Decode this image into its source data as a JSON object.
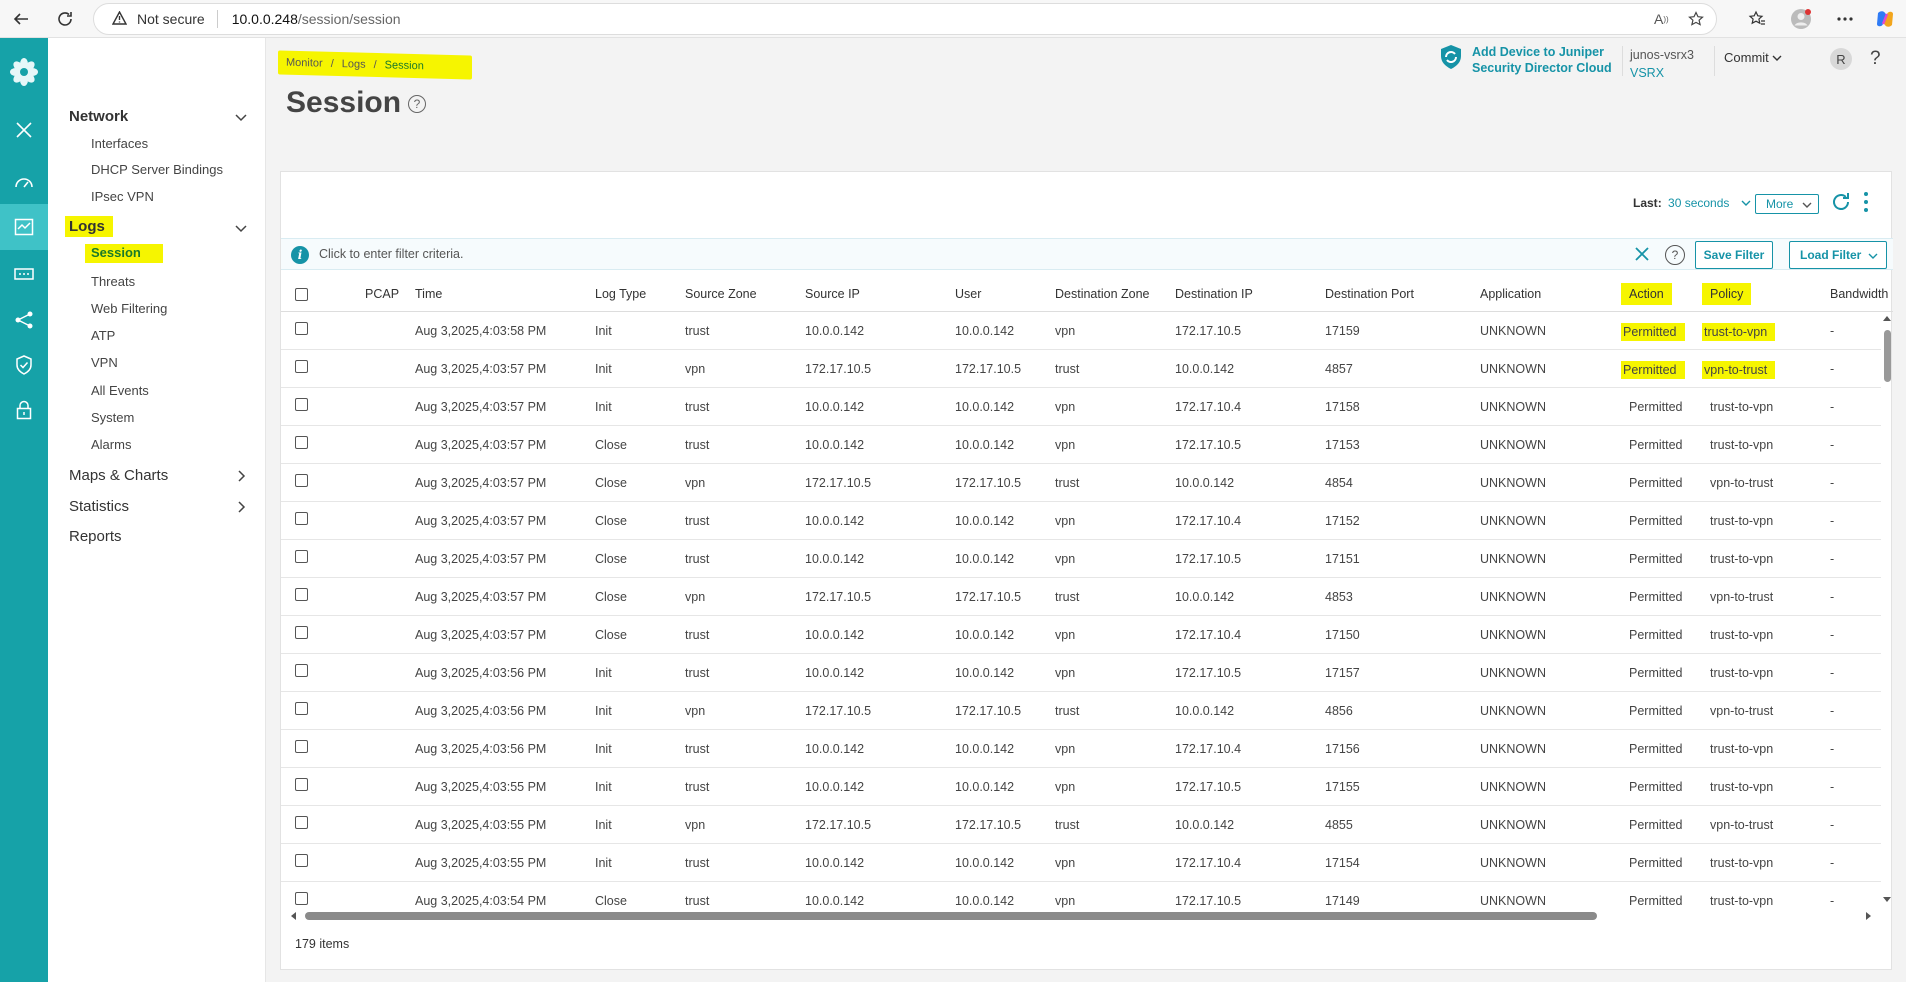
{
  "browser": {
    "security_label": "Not secure",
    "url_host": "10.0.0.248",
    "url_path": "/session/session"
  },
  "sidebar": {
    "sections": [
      {
        "label": "Network",
        "items": [
          "Interfaces",
          "DHCP Server Bindings",
          "IPsec VPN"
        ]
      },
      {
        "label": "Logs",
        "items": [
          "Session",
          "Threats",
          "Web Filtering",
          "ATP",
          "VPN",
          "All Events",
          "System",
          "Alarms"
        ]
      },
      {
        "label": "Maps & Charts"
      },
      {
        "label": "Statistics"
      },
      {
        "label": "Reports"
      }
    ]
  },
  "header": {
    "breadcrumb": [
      "Monitor",
      "/",
      "Logs",
      "/",
      "Session"
    ],
    "title": "Session",
    "add_device_line1": "Add Device to Juniper",
    "add_device_line2": "Security Director Cloud",
    "device_name": "junos-vsrx3",
    "device_model": "VSRX",
    "commit_label": "Commit",
    "avatar_initial": "R",
    "help_label": "?"
  },
  "toolbar": {
    "last_label": "Last",
    "last_value": "30 seconds",
    "more_label": "More"
  },
  "filter": {
    "placeholder": "Click to enter filter criteria.",
    "save_label": "Save Filter",
    "load_label": "Load Filter"
  },
  "table": {
    "columns": [
      "PCAP",
      "Time",
      "Log Type",
      "Source Zone",
      "Source IP",
      "User",
      "Destination Zone",
      "Destination IP",
      "Destination Port",
      "Application",
      "Action",
      "Policy",
      "Bandwidth"
    ],
    "rows": [
      [
        "",
        "Aug 3,2025,4:03:58 PM",
        "Init",
        "trust",
        "10.0.0.142",
        "10.0.0.142",
        "vpn",
        "172.17.10.5",
        "17159",
        "UNKNOWN",
        "Permitted",
        "trust-to-vpn",
        "-"
      ],
      [
        "",
        "Aug 3,2025,4:03:57 PM",
        "Init",
        "vpn",
        "172.17.10.5",
        "172.17.10.5",
        "trust",
        "10.0.0.142",
        "4857",
        "UNKNOWN",
        "Permitted",
        "vpn-to-trust",
        "-"
      ],
      [
        "",
        "Aug 3,2025,4:03:57 PM",
        "Init",
        "trust",
        "10.0.0.142",
        "10.0.0.142",
        "vpn",
        "172.17.10.4",
        "17158",
        "UNKNOWN",
        "Permitted",
        "trust-to-vpn",
        "-"
      ],
      [
        "",
        "Aug 3,2025,4:03:57 PM",
        "Close",
        "trust",
        "10.0.0.142",
        "10.0.0.142",
        "vpn",
        "172.17.10.5",
        "17153",
        "UNKNOWN",
        "Permitted",
        "trust-to-vpn",
        "-"
      ],
      [
        "",
        "Aug 3,2025,4:03:57 PM",
        "Close",
        "vpn",
        "172.17.10.5",
        "172.17.10.5",
        "trust",
        "10.0.0.142",
        "4854",
        "UNKNOWN",
        "Permitted",
        "vpn-to-trust",
        "-"
      ],
      [
        "",
        "Aug 3,2025,4:03:57 PM",
        "Close",
        "trust",
        "10.0.0.142",
        "10.0.0.142",
        "vpn",
        "172.17.10.4",
        "17152",
        "UNKNOWN",
        "Permitted",
        "trust-to-vpn",
        "-"
      ],
      [
        "",
        "Aug 3,2025,4:03:57 PM",
        "Close",
        "trust",
        "10.0.0.142",
        "10.0.0.142",
        "vpn",
        "172.17.10.5",
        "17151",
        "UNKNOWN",
        "Permitted",
        "trust-to-vpn",
        "-"
      ],
      [
        "",
        "Aug 3,2025,4:03:57 PM",
        "Close",
        "vpn",
        "172.17.10.5",
        "172.17.10.5",
        "trust",
        "10.0.0.142",
        "4853",
        "UNKNOWN",
        "Permitted",
        "vpn-to-trust",
        "-"
      ],
      [
        "",
        "Aug 3,2025,4:03:57 PM",
        "Close",
        "trust",
        "10.0.0.142",
        "10.0.0.142",
        "vpn",
        "172.17.10.4",
        "17150",
        "UNKNOWN",
        "Permitted",
        "trust-to-vpn",
        "-"
      ],
      [
        "",
        "Aug 3,2025,4:03:56 PM",
        "Init",
        "trust",
        "10.0.0.142",
        "10.0.0.142",
        "vpn",
        "172.17.10.5",
        "17157",
        "UNKNOWN",
        "Permitted",
        "trust-to-vpn",
        "-"
      ],
      [
        "",
        "Aug 3,2025,4:03:56 PM",
        "Init",
        "vpn",
        "172.17.10.5",
        "172.17.10.5",
        "trust",
        "10.0.0.142",
        "4856",
        "UNKNOWN",
        "Permitted",
        "vpn-to-trust",
        "-"
      ],
      [
        "",
        "Aug 3,2025,4:03:56 PM",
        "Init",
        "trust",
        "10.0.0.142",
        "10.0.0.142",
        "vpn",
        "172.17.10.4",
        "17156",
        "UNKNOWN",
        "Permitted",
        "trust-to-vpn",
        "-"
      ],
      [
        "",
        "Aug 3,2025,4:03:55 PM",
        "Init",
        "trust",
        "10.0.0.142",
        "10.0.0.142",
        "vpn",
        "172.17.10.5",
        "17155",
        "UNKNOWN",
        "Permitted",
        "trust-to-vpn",
        "-"
      ],
      [
        "",
        "Aug 3,2025,4:03:55 PM",
        "Init",
        "vpn",
        "172.17.10.5",
        "172.17.10.5",
        "trust",
        "10.0.0.142",
        "4855",
        "UNKNOWN",
        "Permitted",
        "vpn-to-trust",
        "-"
      ],
      [
        "",
        "Aug 3,2025,4:03:55 PM",
        "Init",
        "trust",
        "10.0.0.142",
        "10.0.0.142",
        "vpn",
        "172.17.10.4",
        "17154",
        "UNKNOWN",
        "Permitted",
        "trust-to-vpn",
        "-"
      ],
      [
        "",
        "Aug 3,2025,4:03:54 PM",
        "Close",
        "trust",
        "10.0.0.142",
        "10.0.0.142",
        "vpn",
        "172.17.10.5",
        "17149",
        "UNKNOWN",
        "Permitted",
        "trust-to-vpn",
        "-"
      ]
    ],
    "items_count": "179 items"
  },
  "colors": {
    "rail": "#16a2a8",
    "accent": "#1693a7",
    "highlight": "#f6f500",
    "active_link": "#1a7a2a"
  },
  "icons": {
    "rail": [
      "juniper-logo-icon",
      "close-icon",
      "dashboard-icon",
      "monitor-icon",
      "devices-icon",
      "network-icon",
      "security-policy-icon",
      "lock-icon"
    ]
  }
}
